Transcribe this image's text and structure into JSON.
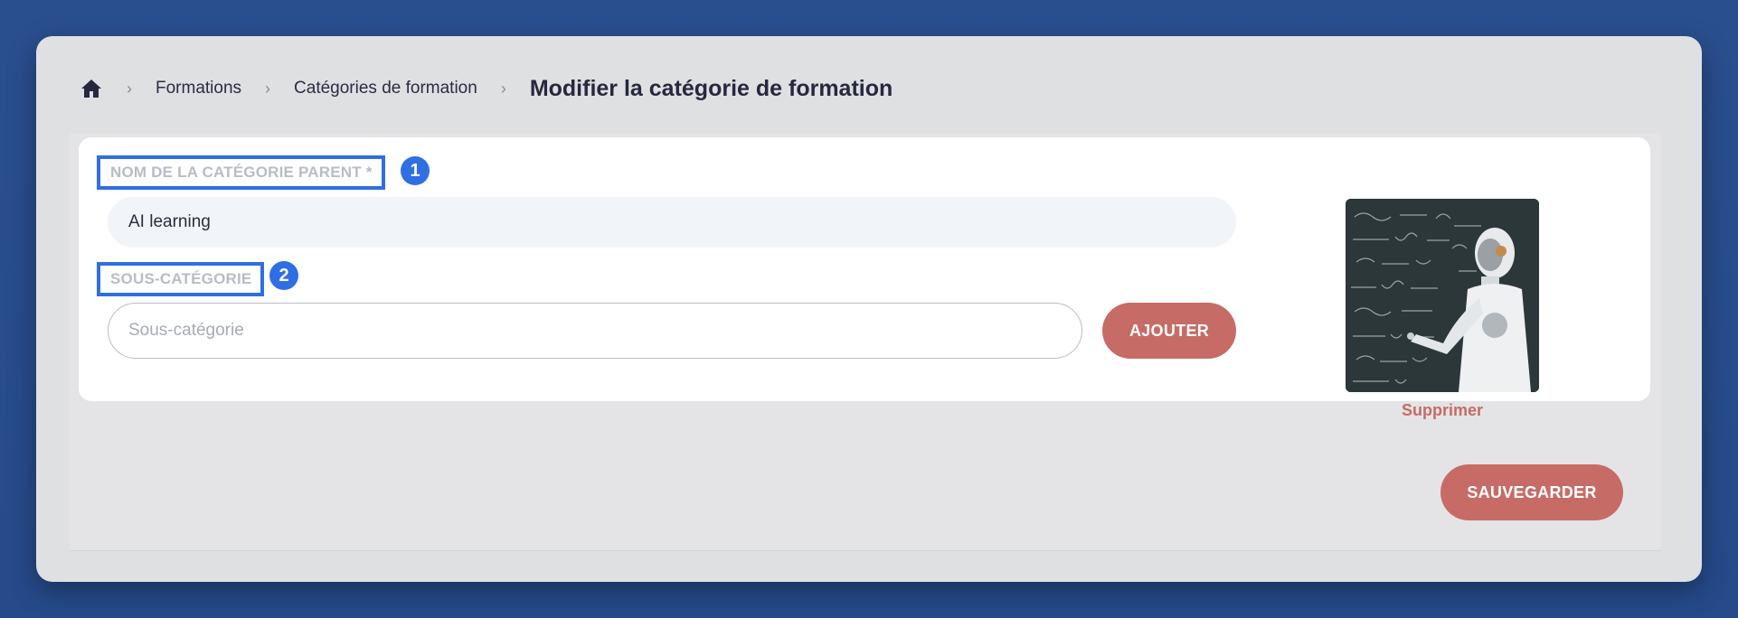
{
  "breadcrumb": {
    "home_icon": "home-icon",
    "items": [
      "Formations",
      "Catégories de formation"
    ],
    "current": "Modifier la catégorie de formation"
  },
  "form": {
    "parent_label": "NOM DE LA CATÉGORIE PARENT *",
    "parent_badge": "1",
    "parent_value": "AI learning",
    "sub_label": "SOUS-CATÉGORIE",
    "sub_badge": "2",
    "sub_placeholder": "Sous-catégorie",
    "add_button": "AJOUTER"
  },
  "image": {
    "delete_label": "Supprimer"
  },
  "save_button": "SAUVEGARDER",
  "colors": {
    "accent": "#c76b66",
    "highlight": "#2f6fe3",
    "background": "#264a8a"
  }
}
